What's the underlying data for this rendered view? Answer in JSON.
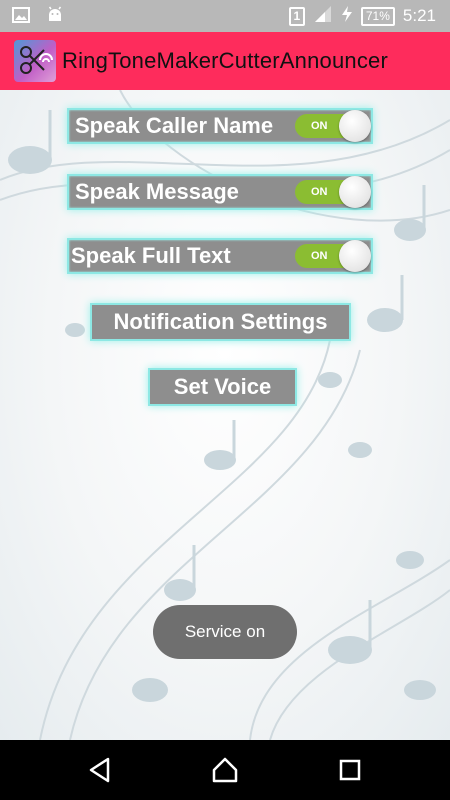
{
  "status_bar": {
    "sim_slot": "1",
    "battery": "71%",
    "time": "5:21",
    "icons": [
      "gallery-icon",
      "android-icon",
      "signal-icon",
      "charging-icon"
    ]
  },
  "app_bar": {
    "title": "RingToneMakerCutterAnnouncer",
    "background_color": "#fe2c5c"
  },
  "settings": {
    "toggles": [
      {
        "label": "Speak Caller Name",
        "state": "ON"
      },
      {
        "label": "Speak Message",
        "state": "ON"
      },
      {
        "label": "Speak Full Text",
        "state": "ON"
      }
    ],
    "notification_button": "Notification Settings",
    "voice_button": "Set Voice"
  },
  "toast": {
    "message": "Service on"
  },
  "nav_bar": {
    "icons": [
      "back-icon",
      "home-icon",
      "recents-icon"
    ]
  },
  "colors": {
    "accent": "#fe2c5c",
    "button_bg": "#8e8e8e",
    "button_glow": "#8de8e4",
    "switch_on": "#8bbd32"
  }
}
